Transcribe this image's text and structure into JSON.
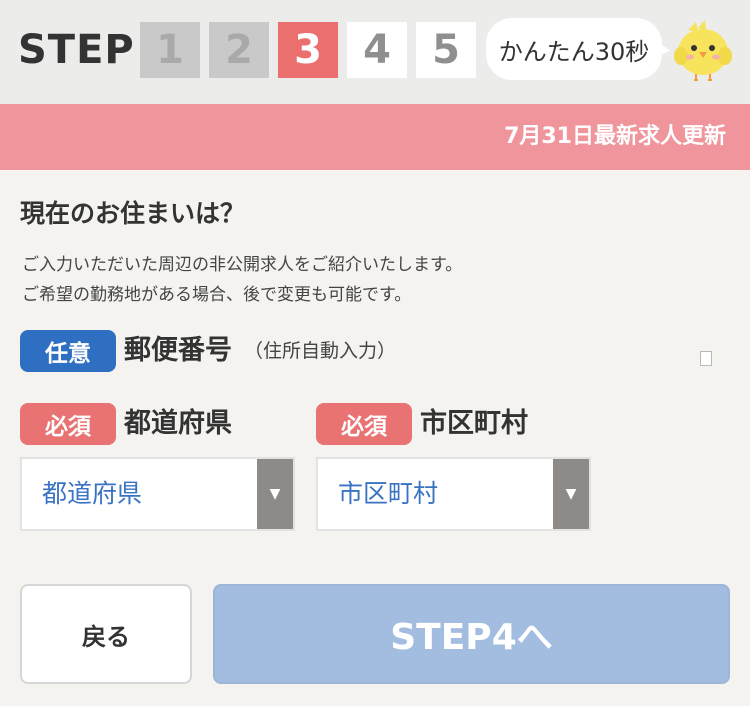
{
  "header": {
    "step_label": "STEP",
    "steps": [
      {
        "number": "1",
        "state": "done"
      },
      {
        "number": "2",
        "state": "done"
      },
      {
        "number": "3",
        "state": "current"
      },
      {
        "number": "4",
        "state": "todo"
      },
      {
        "number": "5",
        "state": "todo"
      }
    ],
    "bubble_text": "かんたん30秒",
    "mascot_icon": "chick-icon"
  },
  "banner": {
    "text": "7月31日最新求人更新"
  },
  "question": {
    "title": "現在のお住まいは？",
    "description_line1": "ご入力いただいた周辺の非公開求人をご紹介いたします。",
    "description_line2": "ご希望の勤務地がある場合、後で変更も可能です。"
  },
  "postal": {
    "badge": "任意",
    "label": "郵便番号",
    "note": "（住所自動入力）"
  },
  "prefecture": {
    "badge": "必須",
    "label": "都道府県",
    "selected": "都道府県"
  },
  "city": {
    "badge": "必須",
    "label": "市区町村",
    "selected": "市区町村"
  },
  "buttons": {
    "back_label": "戻る",
    "next_label": "STEP4へ"
  },
  "colors": {
    "current_step": "#ec6f6f",
    "banner": "#ef959b",
    "optional_badge": "#2f6fc1",
    "required_badge": "#e97272",
    "next_button": "#a3bde0"
  }
}
